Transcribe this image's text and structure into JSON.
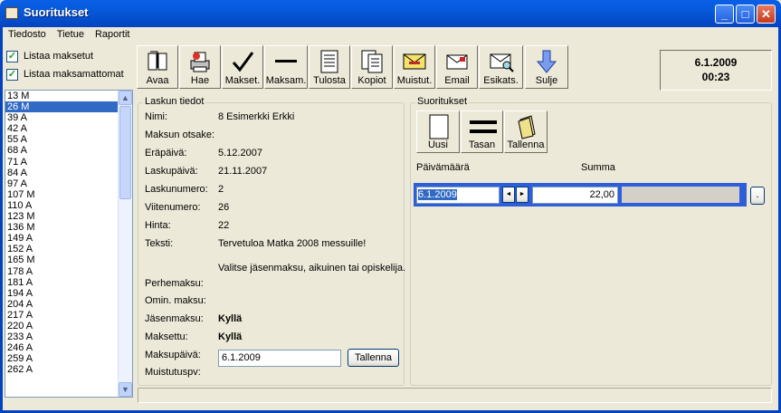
{
  "window": {
    "title": "Suoritukset",
    "minimize_label": "_",
    "maximize_label": "□",
    "close_label": "✕"
  },
  "menu": [
    "Tiedosto",
    "Tietue",
    "Raportit"
  ],
  "options": {
    "show_paid": "Listaa maksetut",
    "show_unpaid": "Listaa maksamattomat",
    "show_paid_checked": true,
    "show_unpaid_checked": true
  },
  "toolbar": [
    {
      "label": "Avaa",
      "icon": "open-book-icon"
    },
    {
      "label": "Hae",
      "icon": "search-printer-icon"
    },
    {
      "label": "Makset.",
      "icon": "checkmark-icon"
    },
    {
      "label": "Maksam.",
      "icon": "dash-icon"
    },
    {
      "label": "Tulosta",
      "icon": "document-icon"
    },
    {
      "label": "Kopiot",
      "icon": "copies-icon"
    },
    {
      "label": "Muistut.",
      "icon": "envelope-yellow-icon"
    },
    {
      "label": "Email",
      "icon": "email-icon"
    },
    {
      "label": "Esikats.",
      "icon": "preview-icon"
    },
    {
      "label": "Sulje",
      "icon": "down-arrow-icon"
    }
  ],
  "clock": {
    "date": "6.1.2009",
    "time": "00:23"
  },
  "invoice_list": {
    "items": [
      "13 M",
      "26 M",
      "39 A",
      "42 A",
      "55 A",
      "68 A",
      "71 A",
      "84 A",
      "97 A",
      "107 M",
      "110 A",
      "123 M",
      "136 M",
      "149 A",
      "152 A",
      "165 M",
      "178 A",
      "181 A",
      "194 A",
      "204 A",
      "217 A",
      "220 A",
      "233 A",
      "246 A",
      "259 A",
      "262 A"
    ],
    "selected_index": 1
  },
  "invoice_details": {
    "group_label": "Laskun tiedot",
    "fields": [
      {
        "label": "Nimi:",
        "value": "8 Esimerkki Erkki"
      },
      {
        "label": "Maksun otsake:",
        "value": ""
      },
      {
        "label": "Eräpäivä:",
        "value": "5.12.2007"
      },
      {
        "label": "Laskupäivä:",
        "value": "21.11.2007"
      },
      {
        "label": "Laskunumero:",
        "value": "2"
      },
      {
        "label": "Viitenumero:",
        "value": "26"
      },
      {
        "label": "Hinta:",
        "value": "22"
      },
      {
        "label": "Teksti:",
        "value": "Tervetuloa Matka 2008 messuille!"
      }
    ],
    "text_line2": "Valitse jäsenmaksu, aikuinen tai opiskelija.",
    "perhemaksu_label": "Perhemaksu:",
    "omin_label": "Omin. maksu:",
    "jasen_label": "Jäsenmaksu:",
    "jasen_value": "Kyllä",
    "maksettu_label": "Maksettu:",
    "maksettu_value": "Kyllä",
    "maksupaiva_label": "Maksupäivä:",
    "maksupaiva_value": "6.1.2009",
    "save_label": "Tallenna",
    "muistutus_label": "Muistutuspv:"
  },
  "payments": {
    "group_label": "Suoritukset",
    "buttons": [
      {
        "label": "Uusi",
        "icon": "blank-page-icon"
      },
      {
        "label": "Tasan",
        "icon": "equals-icon"
      },
      {
        "label": "Tallenna",
        "icon": "save-page-icon"
      }
    ],
    "col_date": "Päivämäärä",
    "col_sum": "Summa",
    "row": {
      "date": "6.1.2009",
      "sum": "22,00"
    },
    "prev_label": "◄",
    "next_label": "►",
    "dot_label": "."
  }
}
